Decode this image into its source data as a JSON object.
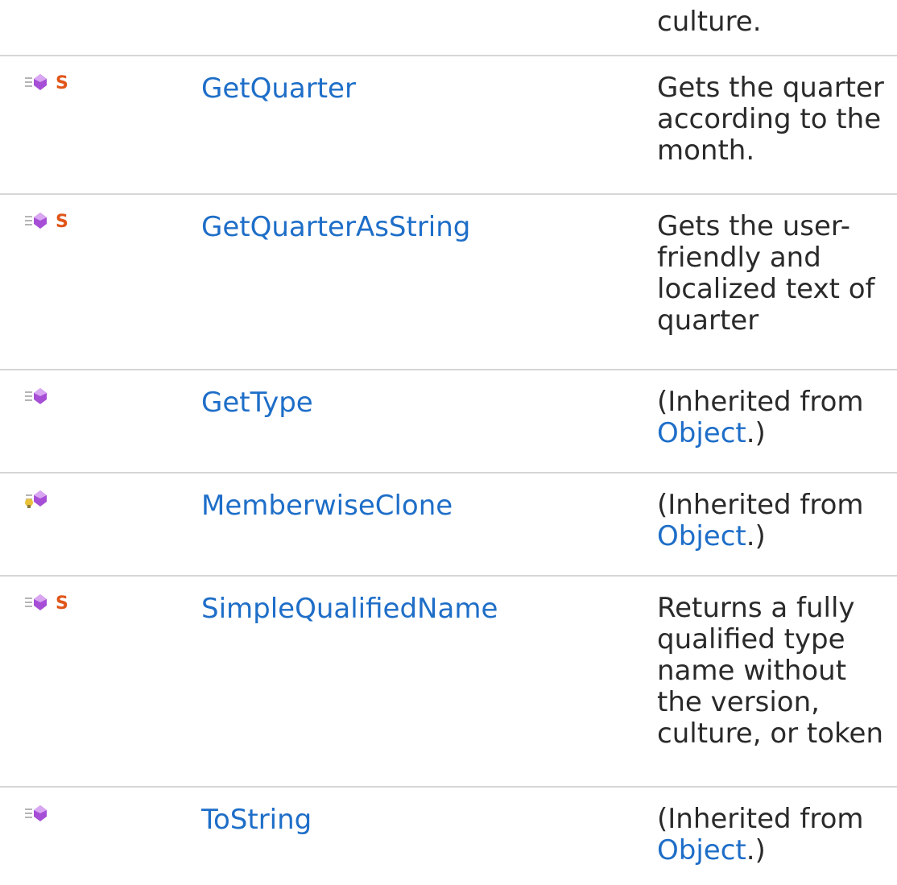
{
  "top_fragment": "culture.",
  "members": [
    {
      "icons": [
        "public-method-icon",
        "static-icon"
      ],
      "name": "GetQuarter",
      "description_lines": [
        "Gets the quarter",
        "according to the",
        "month."
      ]
    },
    {
      "icons": [
        "public-method-icon",
        "static-icon"
      ],
      "name": "GetQuarterAsString",
      "description_lines": [
        "Gets the user-",
        "friendly and",
        "localized text of",
        "quarter"
      ]
    },
    {
      "icons": [
        "public-method-icon"
      ],
      "name": "GetType",
      "inherited_prefix": "(Inherited from",
      "inherited_link": "Object",
      "inherited_suffix": ".)"
    },
    {
      "icons": [
        "protected-method-icon"
      ],
      "name": "MemberwiseClone",
      "inherited_prefix": "(Inherited from",
      "inherited_link": "Object",
      "inherited_suffix": ".)"
    },
    {
      "icons": [
        "public-method-icon",
        "static-icon"
      ],
      "name": "SimpleQualifiedName",
      "description_lines": [
        "Returns a fully",
        "qualified type",
        "name without",
        "the version,",
        "culture, or token"
      ]
    },
    {
      "icons": [
        "public-method-icon"
      ],
      "name": "ToString",
      "inherited_prefix": "(Inherited from",
      "inherited_link": "Object",
      "inherited_suffix": ".)"
    }
  ],
  "colors": {
    "link": "#1e6ec8",
    "text": "#2a2a2a",
    "divider": "#d6d6d6",
    "method_purple": "#a64fd6",
    "static_orange": "#e0561a"
  }
}
